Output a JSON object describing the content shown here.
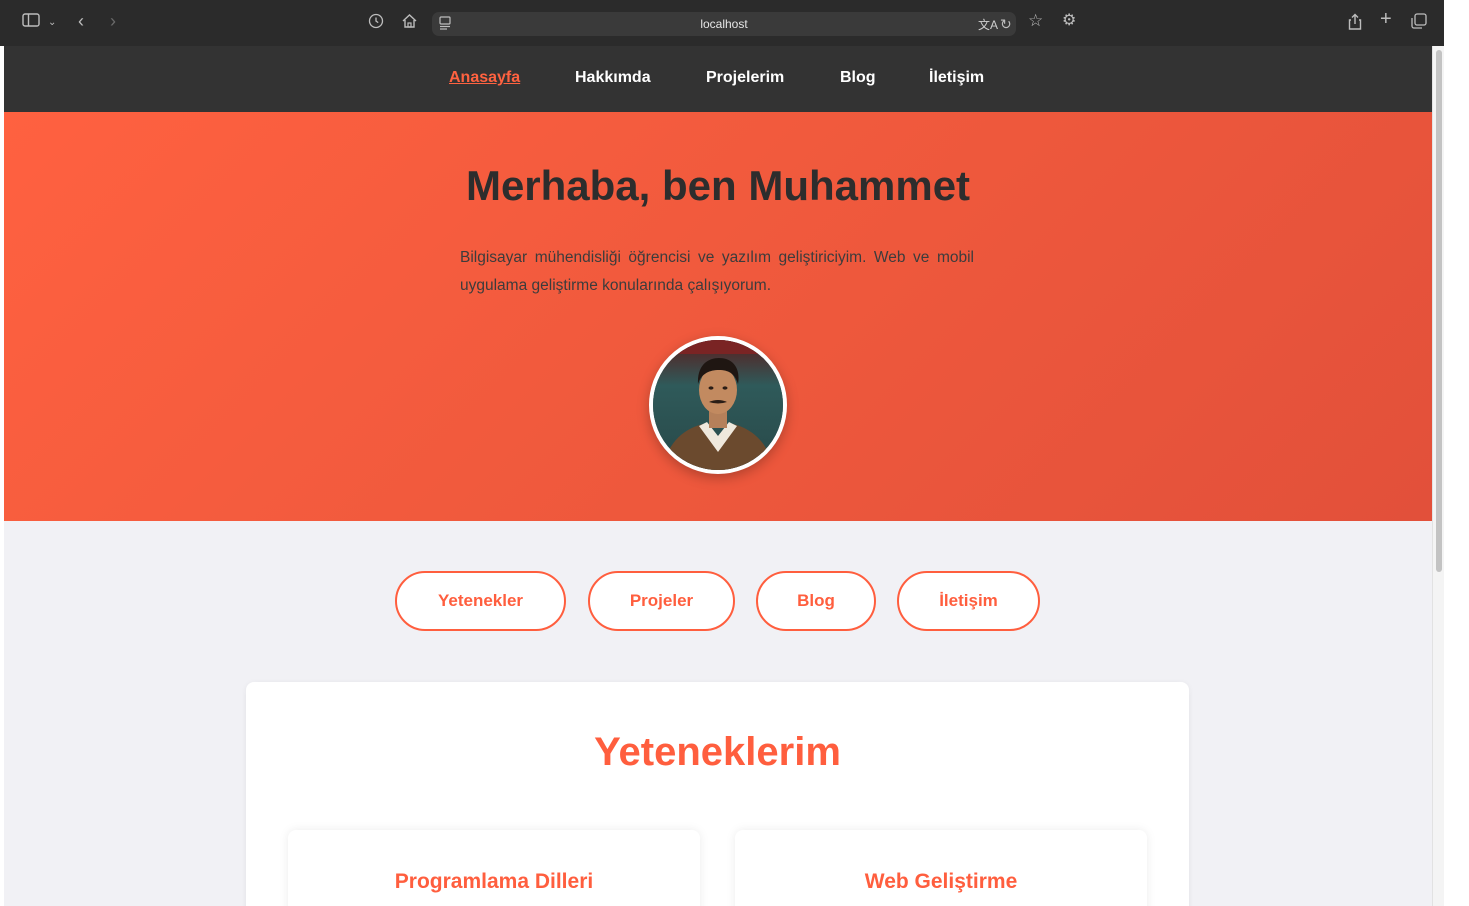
{
  "browser": {
    "url": "localhost"
  },
  "nav": {
    "items": [
      "Anasayfa",
      "Hakkımda",
      "Projelerim",
      "Blog",
      "İletişim"
    ]
  },
  "hero": {
    "title": "Merhaba, ben Muhammet",
    "description": "Bilgisayar mühendisliği öğrencisi ve yazılım geliştiriciyim. Web ve mobil uygulama geliştirme konularında çalışıyorum."
  },
  "section_buttons": [
    "Yetenekler",
    "Projeler",
    "Blog",
    "İletişim"
  ],
  "skills": {
    "title": "Yeteneklerim",
    "categories": [
      "Programlama Dilleri",
      "Web Geliştirme"
    ]
  },
  "colors": {
    "accent": "#ff5e3e",
    "nav_background": "#333333",
    "hero_gradient_start": "#ff6140",
    "hero_gradient_end": "#e2503a"
  },
  "icons": [
    "sidebar-toggle-icon",
    "chevron-down-icon",
    "back-icon",
    "forward-icon",
    "history-icon",
    "home-icon",
    "page-menu-icon",
    "translate-icon",
    "reload-icon",
    "bookmark-star-icon",
    "extensions-icon",
    "share-icon",
    "new-tab-icon",
    "tabs-overview-icon"
  ]
}
